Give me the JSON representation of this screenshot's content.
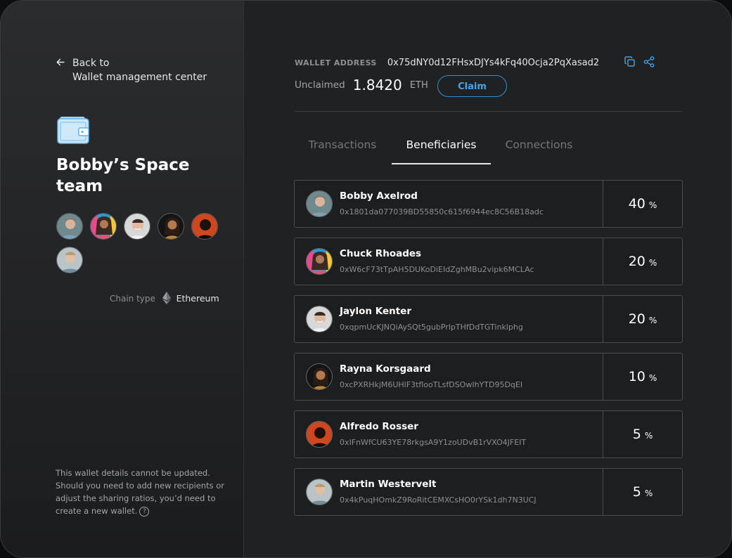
{
  "sidebar": {
    "back_line1": "Back to",
    "back_line2": "Wallet management center",
    "team_name": "Bobby’s Space team",
    "chain_label": "Chain type",
    "chain_value": "Ethereum",
    "note": "This wallet details cannot be updated. Should you need to add new recipients or adjust the sharing ratios, you’d need to create a new wallet."
  },
  "wallet": {
    "address_label": "WALLET ADDRESS",
    "address": "0x75dNY0d12FHsxDJYs4kFq40Ocja2PqXasad2",
    "unclaimed_label": "Unclaimed",
    "unclaimed_value": "1.8420",
    "unclaimed_unit": "ETH",
    "claim_label": "Claim"
  },
  "tabs": [
    {
      "label": "Transactions"
    },
    {
      "label": "Beneficiaries"
    },
    {
      "label": "Connections"
    }
  ],
  "beneficiaries": [
    {
      "name": "Bobby Axelrod",
      "address": "0x1801da077039BD55850c615f6944ec8C56B18adc",
      "share": "40",
      "unit": "%"
    },
    {
      "name": "Chuck Rhoades",
      "address": "0xW6cF73tTpAH5DUKoDiEIdZghMBu2vipk6MCLAc",
      "share": "20",
      "unit": "%"
    },
    {
      "name": "Jaylon Kenter",
      "address": "0xqpmUcKJNQiAySQt5gubPrlpTHfDdTGTinklphg",
      "share": "20",
      "unit": "%"
    },
    {
      "name": "Rayna Korsgaard",
      "address": "0xcPXRHkjM6UHlF3tflooTLsfDSOwIhYTD95DqEI",
      "share": "10",
      "unit": "%"
    },
    {
      "name": "Alfredo Rosser",
      "address": "0xIFnWfCU63YE78rkgsA9Y1zoUDvB1rVXO4JFEIT",
      "share": "5",
      "unit": "%"
    },
    {
      "name": "Martin Westervelt",
      "address": "0x4kPuqHOmkZ9RoRitCEMXCsHO0rYSk1dh7N3UCJ",
      "share": "5",
      "unit": "%"
    }
  ],
  "colors": {
    "accent": "#2b8fdc",
    "background": "#202123",
    "sidebar": "#2b2c2f"
  }
}
